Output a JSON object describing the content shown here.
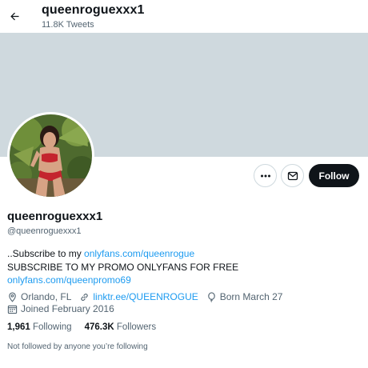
{
  "header": {
    "name": "queenroguexxx1",
    "tweet_count": "11.8K Tweets"
  },
  "profile": {
    "display_name": "queenroguexxx1",
    "handle": "@queenroguexxx1",
    "bio": {
      "line1_prefix": "..Subscribe to my ",
      "line1_link": "onlyfans.com/queenrogue",
      "line2": "SUBSCRIBE TO MY PROMO ONLYFANS FOR FREE",
      "line3_link": "onlyfans.com/queenpromo69"
    },
    "location": "Orlando, FL",
    "website": "linktr.ee/QUEENROGUE",
    "birthday": "Born March 27",
    "joined": "Joined February 2016",
    "following_count": "1,961",
    "following_label": "Following",
    "followers_count": "476.3K",
    "followers_label": "Followers",
    "not_followed_text": "Not followed by anyone you’re following"
  },
  "actions": {
    "follow_label": "Follow",
    "more_icon": "more-horizontal-icon",
    "message_icon": "envelope-icon"
  },
  "colors": {
    "accent": "#1d9bf0",
    "banner": "#cfd9de",
    "follow_bg": "#0f1419",
    "secondary_text": "#536471"
  }
}
